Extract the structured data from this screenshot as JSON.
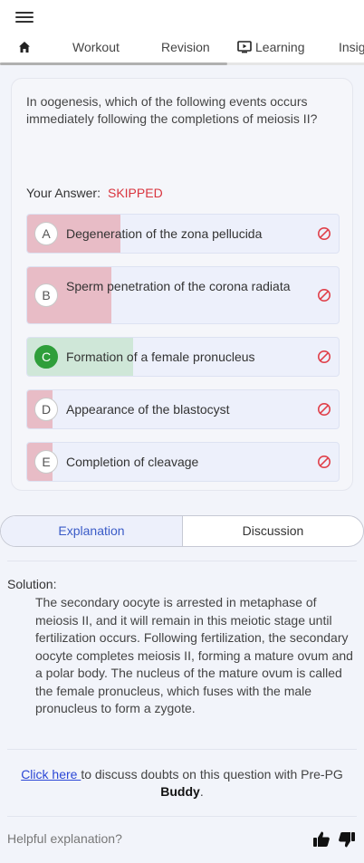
{
  "tabs": {
    "home_icon": "home-icon",
    "workout": "Workout",
    "revision": "Revision",
    "learning": "Learning",
    "learning_icon": "play-screen-icon",
    "insights": "Insig"
  },
  "question": {
    "text": "In oogenesis, which of the following events occurs immediately following the completions of meiosis II?",
    "your_answer_label": "Your Answer:",
    "your_answer_value": "SKIPPED",
    "options": [
      {
        "letter": "A",
        "text": "Degeneration of the zona pellucida",
        "percent": 30,
        "status": "incorrect"
      },
      {
        "letter": "B",
        "text": "Sperm penetration of the corona radiata",
        "percent": 27,
        "status": "incorrect"
      },
      {
        "letter": "C",
        "text": "Formation of a female pronucleus",
        "percent": 34,
        "status": "correct"
      },
      {
        "letter": "D",
        "text": "Appearance of the blastocyst",
        "percent": 8,
        "status": "incorrect"
      },
      {
        "letter": "E",
        "text": "Completion of cleavage",
        "percent": 8,
        "status": "incorrect"
      }
    ]
  },
  "segments": {
    "explanation": "Explanation",
    "discussion": "Discussion",
    "active": "explanation"
  },
  "solution": {
    "label": "Solution:",
    "text": "The secondary oocyte is arrested in metaphase of meiosis II, and it will remain in this meiotic stage until fertilization occurs. Following fertilization, the secondary oocyte completes meiosis II, forming a mature ovum and a polar body. The nucleus of the mature ovum is called the female pronucleus, which fuses with the male pronucleus to form a zygote."
  },
  "discuss": {
    "link": "Click here ",
    "text": "to discuss doubts on this question with Pre-PG ",
    "brand": "Buddy",
    "suffix": "."
  },
  "feedback": {
    "label": "Helpful explanation?"
  },
  "colors": {
    "accent": "#3a5bc7",
    "incorrect_fill": "#e8bcc6",
    "correct_fill": "#cfe7d8",
    "correct_badge": "#2e9e3a",
    "blocked_icon": "#e0404a",
    "skipped": "#d9353f"
  }
}
